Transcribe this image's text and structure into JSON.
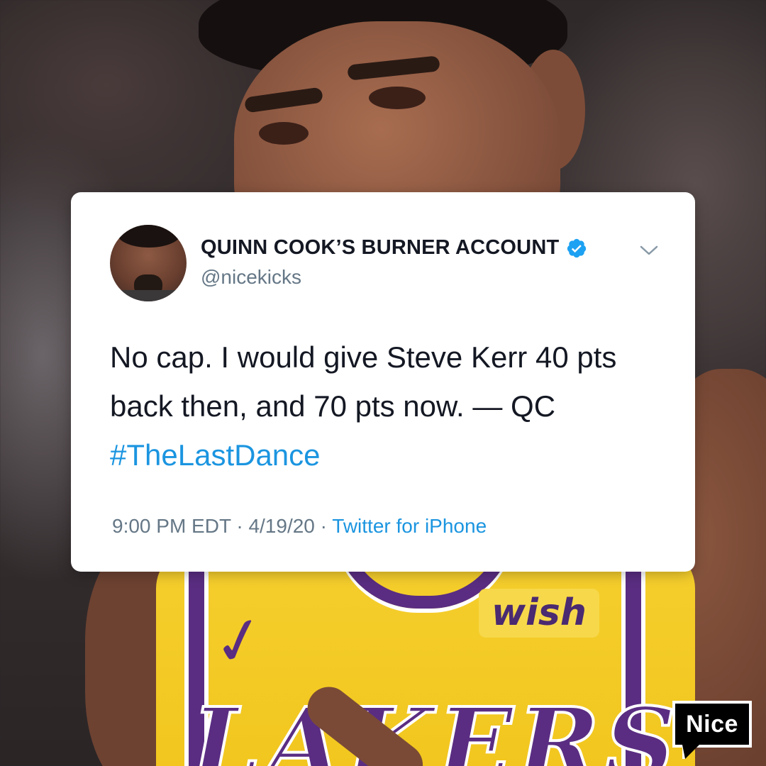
{
  "tweet": {
    "display_name": "QUINN COOK’S BURNER ACCOUNT",
    "handle": "@nicekicks",
    "verified_icon": "verified-badge-icon",
    "menu_icon": "chevron-down-icon",
    "text_lines": [
      "No cap. I would give Steve Kerr 40 pts",
      "back then, and 70 pts now. — QC"
    ],
    "hashtag": "#TheLastDance",
    "time": "9:00 PM EDT",
    "separator": " · ",
    "date": "4/19/20",
    "source": "Twitter for iPhone"
  },
  "background": {
    "jersey_sponsor": "wish",
    "jersey_team": "LAKERS"
  },
  "brand": {
    "logo_text": "Nice"
  },
  "colors": {
    "link_blue": "#1b95e0",
    "meta_gray": "#657786",
    "text_dark": "#141823",
    "jersey_gold": "#f5cf2e",
    "jersey_purple": "#5a2d82"
  }
}
